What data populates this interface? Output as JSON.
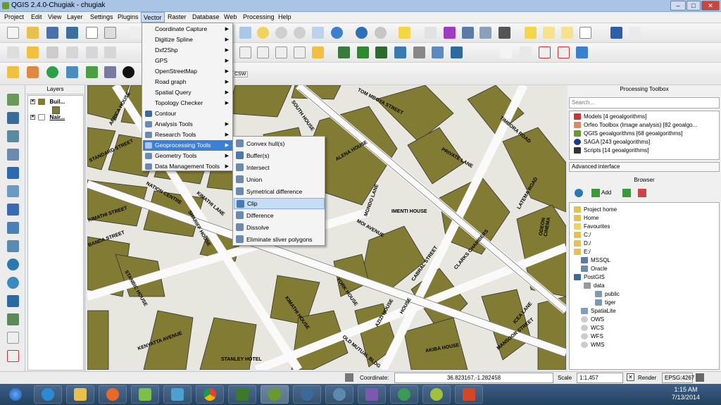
{
  "window": {
    "title": "QGIS 2.4.0-Chugiak - chugiak",
    "min": "–",
    "max": "□",
    "close": "✕"
  },
  "menubar": [
    "Project",
    "Edit",
    "View",
    "Layer",
    "Settings",
    "Plugins",
    "Vector",
    "Raster",
    "Database",
    "Web",
    "Processing",
    "Help"
  ],
  "layers_panel": {
    "title": "Layers",
    "items": [
      {
        "label": "Buil..."
      },
      {
        "label": "Nair..."
      }
    ]
  },
  "vector_menu": [
    {
      "label": "Coordinate Capture",
      "submenu": true
    },
    {
      "label": "Digitize Spline",
      "submenu": true
    },
    {
      "label": "Dxf2Shp",
      "submenu": true
    },
    {
      "label": "GPS",
      "submenu": true
    },
    {
      "label": "OpenStreetMap",
      "submenu": true
    },
    {
      "label": "Road graph",
      "submenu": true
    },
    {
      "label": "Spatial Query",
      "submenu": true
    },
    {
      "label": "Topology Checker",
      "submenu": true
    },
    {
      "label": "Contour",
      "submenu": false
    },
    {
      "label": "Analysis Tools",
      "submenu": true
    },
    {
      "label": "Research Tools",
      "submenu": true
    },
    {
      "label": "Geoprocessing Tools",
      "submenu": true
    },
    {
      "label": "Geometry Tools",
      "submenu": true
    },
    {
      "label": "Data Management Tools",
      "submenu": true
    }
  ],
  "geoprocessing_submenu": [
    "Convex hull(s)",
    "Buffer(s)",
    "Intersect",
    "Union",
    "Symetrical difference",
    "Clip",
    "Difference",
    "Dissolve",
    "Eliminate sliver polygons"
  ],
  "selected_item": "Clip",
  "csw_label": "CSW",
  "map_labels": [
    "TOM MBOYA STREET",
    "TIMBORA ROAD",
    "SOUTH HOUSE",
    "AFRICA HOUSE",
    "NATION CENTRE",
    "MONDO LANE",
    "IMENTI HOUSE",
    "KIMATHI STREET",
    "KENYATTA AVENUE",
    "MOI AVENUE",
    "CABRAL STREET",
    "STANBIC HOUSE",
    "YORK HOUSE",
    "KIMATHI HOUSE",
    "OLD MUTUAL BLDG",
    "STANLEY HOTEL",
    "AKIBA HOUSE",
    "CLARKS CHAMBERS",
    "LATEMA ROAD",
    "ODEON CINEMA",
    "BANDA STREET",
    "SHARIFF HOUSE",
    "KIMATHI LANE",
    "STANDARD STREET",
    "AZIZI HOUSE",
    "ALENA HOUSE",
    "HOUSE",
    "ICEA LANE",
    "MANSOOR STREET",
    "PRIVATE LANE"
  ],
  "processing_toolbox": {
    "title": "Processing Toolbox",
    "search_placeholder": "Search...",
    "items": [
      "Models [4 geoalgorithms]",
      "Orfeo Toolbox (Image analysis) [82 geoalgo...",
      "QGIS geoalgorithms [68 geoalgorithms]",
      "SAGA [243 geoalgorithms]",
      "Scripts [14 geoalgorithms]"
    ],
    "advanced": "Advanced interface"
  },
  "browser": {
    "title": "Browser",
    "add_label": "Add",
    "items": [
      "Project home",
      "Home",
      "Favourites",
      "C:/",
      "D:/",
      "E:/",
      "MSSQL",
      "Oracle",
      "PostGIS",
      "data",
      "public",
      "tiger",
      "SpatiaLite",
      "OWS",
      "WCS",
      "WFS",
      "WMS"
    ]
  },
  "statusbar": {
    "coord_label": "Coordinate:",
    "coord_value": "36.823167,-1.282458",
    "scale_label": "Scale",
    "scale_value": "1:1,457",
    "render_label": "Render",
    "epsg": "EPSG:4267"
  },
  "clock": {
    "time": "1:15 AM",
    "date": "7/13/2014"
  },
  "colors": {
    "building": "#827b33",
    "road": "#fafafa",
    "highlight": "#3b80d6"
  }
}
